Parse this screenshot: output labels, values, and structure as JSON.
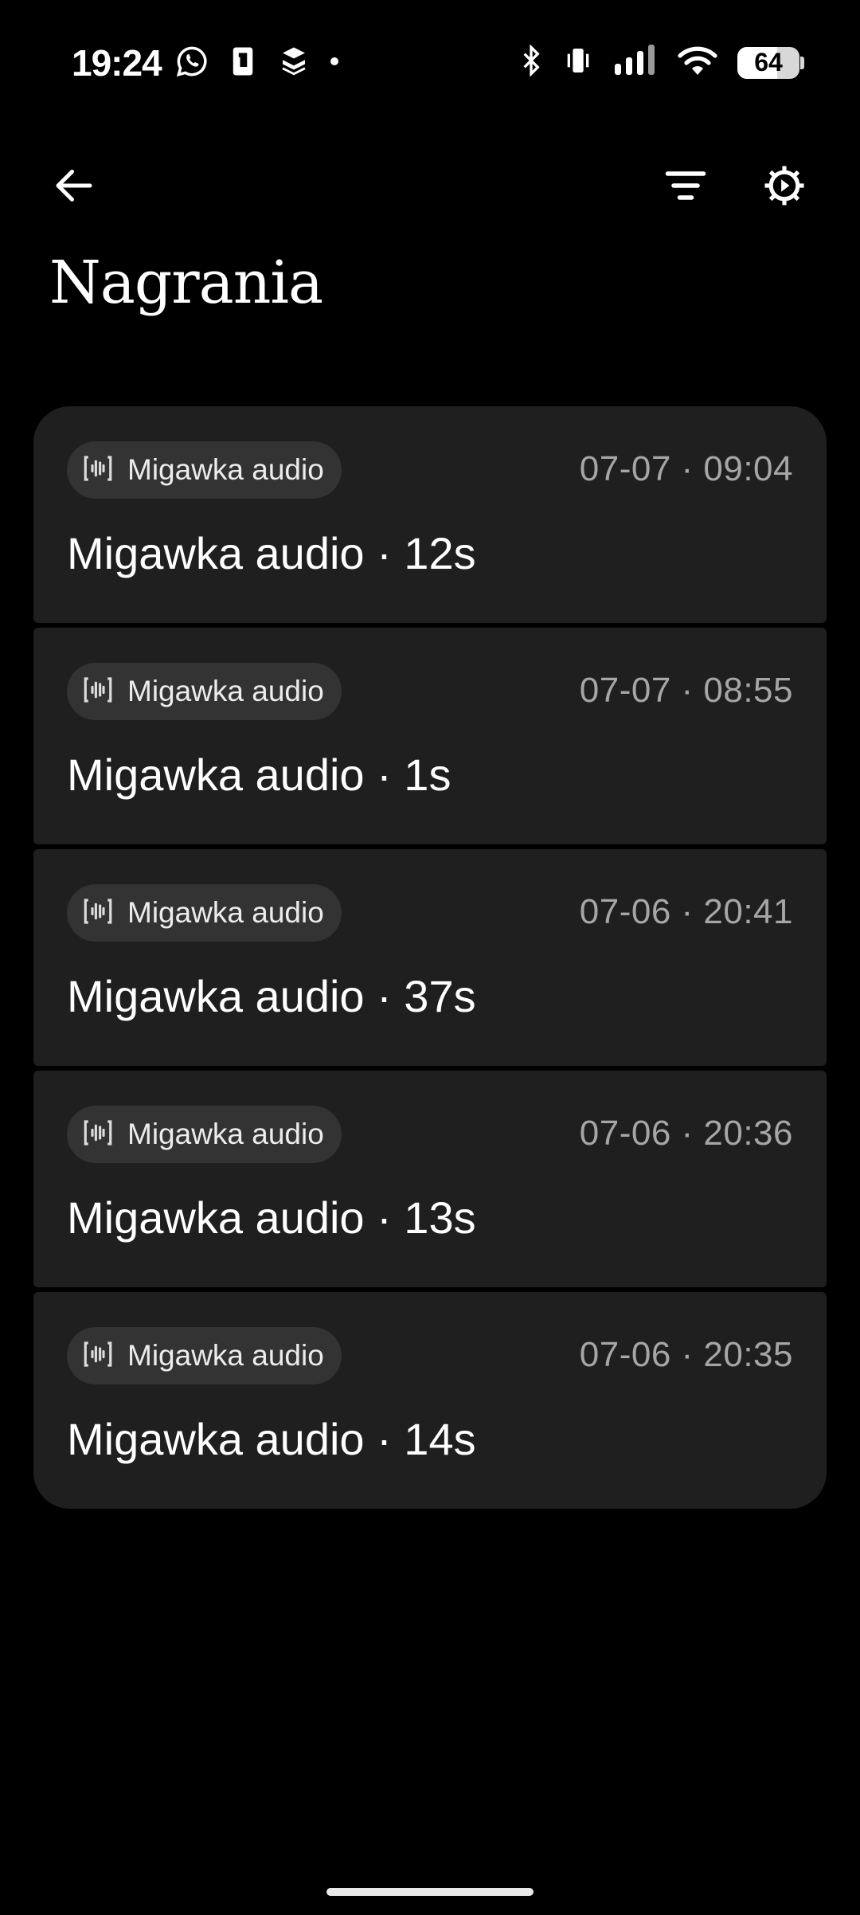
{
  "status_bar": {
    "time": "19:24",
    "battery_level": "64",
    "battery_fraction": 0.64,
    "left_icons": [
      "whatsapp-icon",
      "phone-vibrate-icon",
      "layers-icon",
      "notification-dot-icon"
    ],
    "right_icons": [
      "bluetooth-icon",
      "vibrate-icon",
      "signal-icon",
      "wifi-icon",
      "battery-icon"
    ]
  },
  "app_bar": {
    "back_icon": "arrow-left-icon",
    "filter_icon": "filter-icon",
    "settings_icon": "settings-gear-icon"
  },
  "page": {
    "title": "Nagrania"
  },
  "recordings": [
    {
      "chip_label": "Migawka audio",
      "date": "07-07 · 09:04",
      "title": "Migawka audio · 12s"
    },
    {
      "chip_label": "Migawka audio",
      "date": "07-07 · 08:55",
      "title": "Migawka audio · 1s"
    },
    {
      "chip_label": "Migawka audio",
      "date": "07-06 · 20:41",
      "title": "Migawka audio · 37s"
    },
    {
      "chip_label": "Migawka audio",
      "date": "07-06 · 20:36",
      "title": "Migawka audio · 13s"
    },
    {
      "chip_label": "Migawka audio",
      "date": "07-06 · 20:35",
      "title": "Migawka audio · 14s"
    }
  ],
  "colors": {
    "background": "#000000",
    "card": "#1f1f1f",
    "chip": "#333333",
    "secondary_text": "#a6a6a6"
  }
}
